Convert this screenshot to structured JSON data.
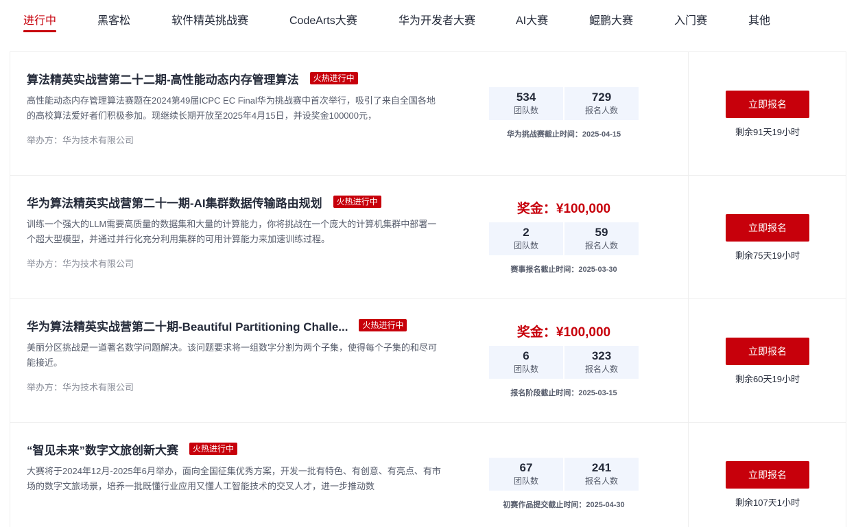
{
  "tabs": [
    {
      "label": "进行中",
      "active": true
    },
    {
      "label": "黑客松"
    },
    {
      "label": "软件精英挑战赛"
    },
    {
      "label": "CodeArts大赛"
    },
    {
      "label": "华为开发者大赛"
    },
    {
      "label": "AI大赛"
    },
    {
      "label": "鲲鹏大赛"
    },
    {
      "label": "入门赛"
    },
    {
      "label": "其他"
    }
  ],
  "competitions": [
    {
      "title": "算法精英实战营第二十二期-高性能动态内存管理算法",
      "badge": "火热进行中",
      "description": "高性能动态内存管理算法赛题在2024第49届ICPC EC Final华为挑战赛中首次举行，吸引了来自全国各地的高校算法爱好者们积极参加。现继续长期开放至2025年4月15日，并设奖金100000元，",
      "organizer": "举办方：华为技术有限公司",
      "prize": "",
      "teams": "534",
      "teams_label": "团队数",
      "signups": "729",
      "signups_label": "报名人数",
      "deadline": "华为挑战赛截止时间：2025-04-15",
      "button": "立即报名",
      "remaining": "剩余91天19小时"
    },
    {
      "title": "华为算法精英实战营第二十一期-AI集群数据传输路由规划",
      "badge": "火热进行中",
      "description": "训练一个强大的LLM需要高质量的数据集和大量的计算能力，你将挑战在一个庞大的计算机集群中部署一个超大型模型，并通过并行化充分利用集群的可用计算能力来加速训练过程。",
      "organizer": "举办方：华为技术有限公司",
      "prize": "奖金：¥100,000",
      "teams": "2",
      "teams_label": "团队数",
      "signups": "59",
      "signups_label": "报名人数",
      "deadline": "赛事报名截止时间：2025-03-30",
      "button": "立即报名",
      "remaining": "剩余75天19小时"
    },
    {
      "title": "华为算法精英实战营第二十期-Beautiful Partitioning Challe...",
      "badge": "火热进行中",
      "description": "美丽分区挑战是一道著名数学问题解决。该问题要求将一组数字分割为两个子集，使得每个子集的和尽可能接近。",
      "organizer": "举办方：华为技术有限公司",
      "prize": "奖金：¥100,000",
      "teams": "6",
      "teams_label": "团队数",
      "signups": "323",
      "signups_label": "报名人数",
      "deadline": "报名阶段截止时间：2025-03-15",
      "button": "立即报名",
      "remaining": "剩余60天19小时"
    },
    {
      "title": "“智见未来”数字文旅创新大赛",
      "badge": "火热进行中",
      "description": "大赛将于2024年12月-2025年6月举办，面向全国征集优秀方案，开发一批有特色、有创意、有亮点、有市场的数字文旅场景，培养一批既懂行业应用又懂人工智能技术的交叉人才，进一步推动数",
      "organizer": "",
      "prize": "",
      "teams": "67",
      "teams_label": "团队数",
      "signups": "241",
      "signups_label": "报名人数",
      "deadline": "初赛作品提交截止时间：2025-04-30",
      "button": "立即报名",
      "remaining": "剩余107天1小时"
    }
  ],
  "colors": {
    "accent": "#c7000b",
    "stat_bg": "#f1f5fd"
  }
}
